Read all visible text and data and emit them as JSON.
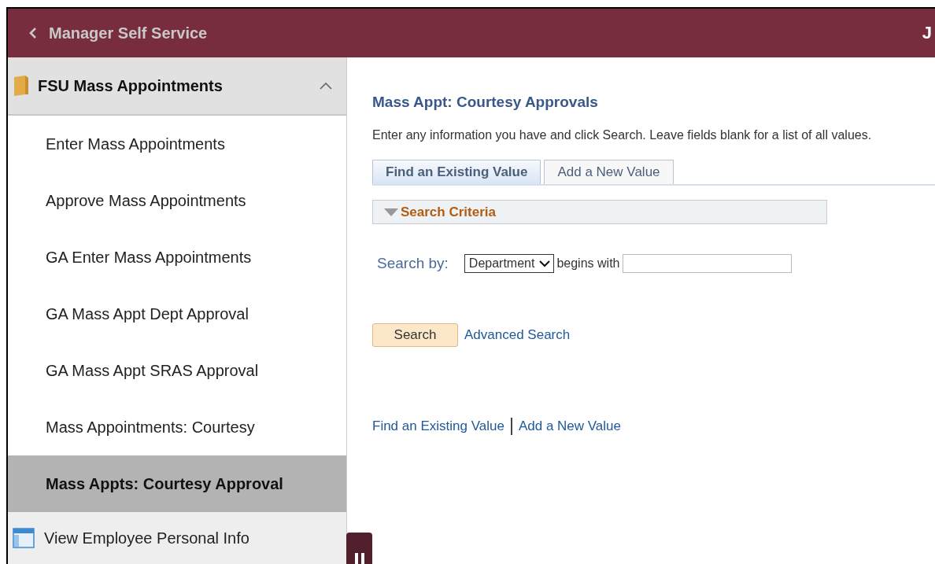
{
  "header": {
    "back_label": "Manager Self Service",
    "user_initial": "J"
  },
  "sidebar": {
    "group": {
      "label": "FSU Mass Appointments",
      "expanded": true
    },
    "items": [
      {
        "label": "Enter Mass Appointments",
        "selected": false
      },
      {
        "label": "Approve Mass Appointments",
        "selected": false
      },
      {
        "label": "GA Enter Mass Appointments",
        "selected": false
      },
      {
        "label": "GA Mass Appt Dept Approval",
        "selected": false
      },
      {
        "label": "GA Mass Appt SRAS Approval",
        "selected": false
      },
      {
        "label": "Mass Appointments: Courtesy",
        "selected": false
      },
      {
        "label": "Mass Appts: Courtesy Approval",
        "selected": true
      }
    ],
    "footer_item": {
      "label": "View Employee Personal Info"
    }
  },
  "main": {
    "title": "Mass Appt: Courtesy Approvals",
    "instructions": "Enter any information you have and click Search. Leave fields blank for a list of all values.",
    "tabs": [
      {
        "label": "Find an Existing Value",
        "selected": true
      },
      {
        "label": "Add a New Value",
        "selected": false
      }
    ],
    "criteria": {
      "label": "Search Criteria",
      "expanded": true
    },
    "search_by": {
      "label": "Search by:",
      "field": "Department",
      "operator": "begins with"
    },
    "search_button": "Search",
    "advanced_link": "Advanced Search",
    "bottom_links": [
      "Find an Existing Value",
      "Add a New Value"
    ]
  }
}
